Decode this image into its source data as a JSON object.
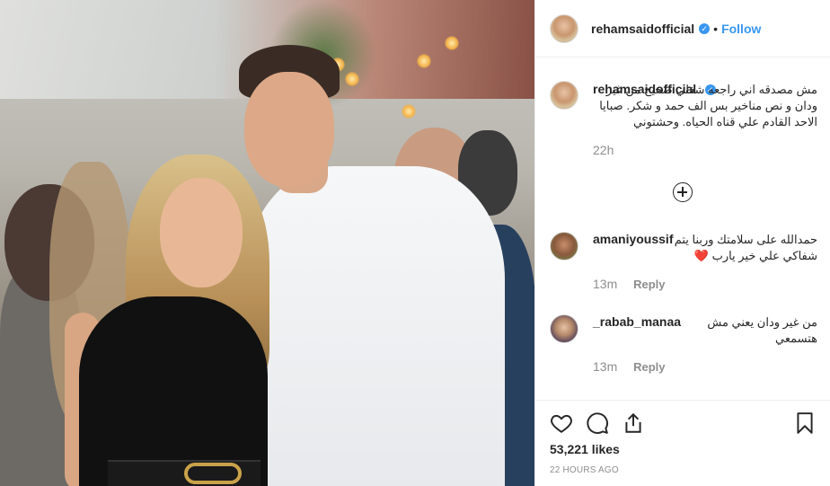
{
  "header": {
    "username": "rehamsaidofficial",
    "separator": "•",
    "follow_label": "Follow",
    "verified_mark": "✓"
  },
  "caption": {
    "username": "rehamsaidofficial",
    "text": "مش مصدقه اني راجعه شغلي صحيح من غير ودان و نص مناخير بس الف حمد و شكر. صبايا الاحد القادم علي قناه الحياه. وحشتوني",
    "time": "22h"
  },
  "comments": [
    {
      "username": "amaniyoussif",
      "text": "حمدالله على سلامتك وربنا يتم شفاكي علي خير يارب ❤️",
      "time": "13m",
      "reply_label": "Reply"
    },
    {
      "username": "_rabab_manaa",
      "text": "من غير ودان يعني مش هتسمعي",
      "time": "13m",
      "reply_label": "Reply"
    }
  ],
  "post": {
    "likes": "53,221 likes",
    "timestamp": "22 HOURS AGO"
  },
  "icons": {
    "like": "heart-icon",
    "comment": "comment-icon",
    "share": "share-icon",
    "save": "bookmark-icon",
    "load_more": "plus-circle-icon"
  },
  "colors": {
    "link_blue": "#3897f0",
    "text": "#262626",
    "meta": "#8e8e8e"
  }
}
